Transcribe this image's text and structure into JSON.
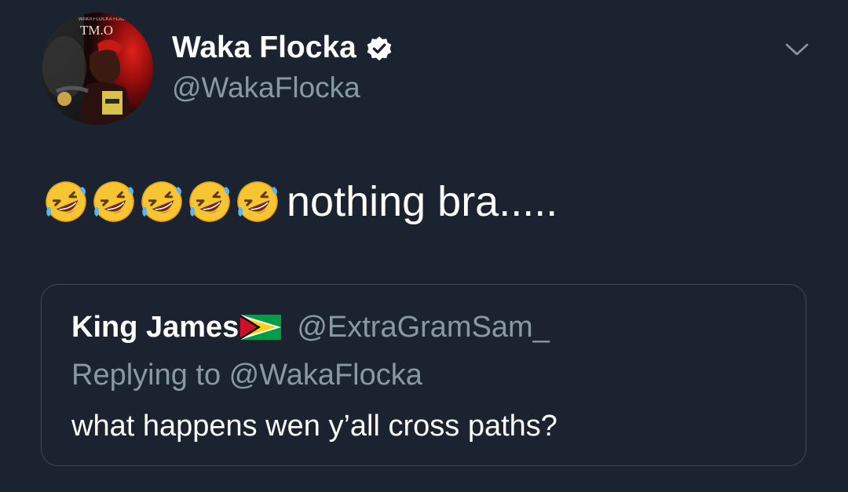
{
  "tweet": {
    "author": {
      "display_name": "Waka Flocka",
      "handle": "@WakaFlocka",
      "verified": true,
      "avatar_caption": "TM.O",
      "avatar_brand_text": "WAKA FLOCKA FLAME"
    },
    "emoji": {
      "name": "rolling-on-the-floor-laughing",
      "count": 5
    },
    "text": "nothing bra.....",
    "menu_icon": "chevron-down-icon"
  },
  "quoted_tweet": {
    "display_name": "King James",
    "flag": "guyana-flag",
    "handle": "@ExtraGramSam_",
    "replying_to": "Replying to @WakaFlocka",
    "text": "what happens wen y’all cross paths?"
  },
  "colors": {
    "background": "#1b2330",
    "primary_text": "#ffffff",
    "secondary_text": "#8899a6",
    "card_border": "#3d4a5a",
    "verified_badge": "#ffffff"
  }
}
